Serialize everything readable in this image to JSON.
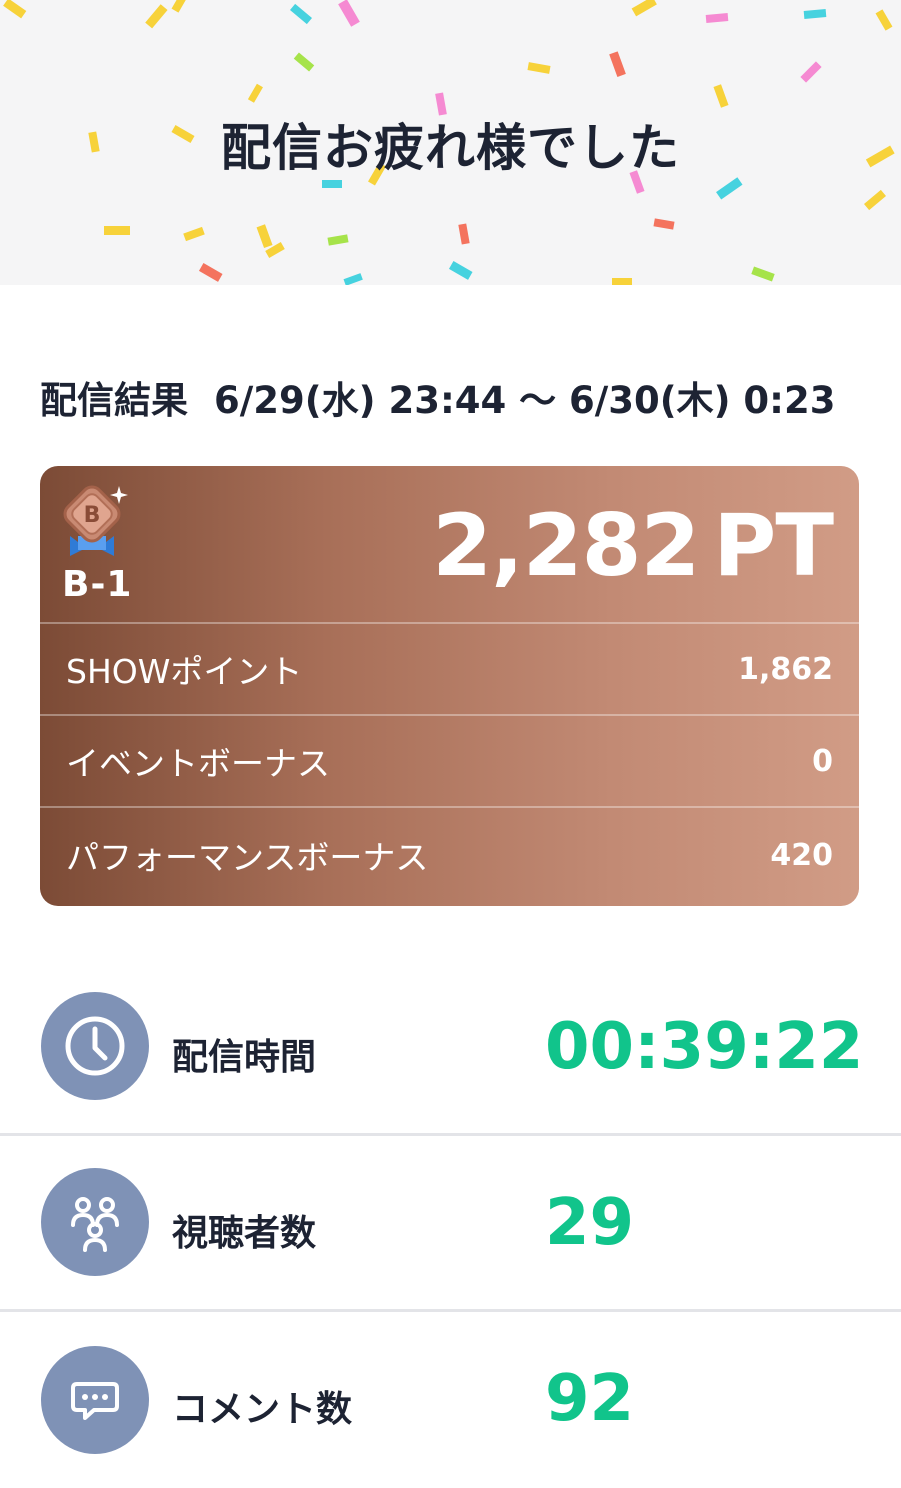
{
  "header": {
    "title": "配信お疲れ様でした"
  },
  "result": {
    "label": "配信結果",
    "period": "6/29(水) 23:44 〜 6/30(木) 0:23"
  },
  "points_card": {
    "rank_letter": "B",
    "rank": "B-1",
    "total_value": "2,282",
    "total_unit": "PT",
    "rows": [
      {
        "label": "SHOWポイント",
        "value": "1,862"
      },
      {
        "label": "イベントボーナス",
        "value": "0"
      },
      {
        "label": "パフォーマンスボーナス",
        "value": "420"
      }
    ]
  },
  "stats": [
    {
      "icon": "clock-icon",
      "label": "配信時間",
      "value": "00:39:22"
    },
    {
      "icon": "viewers-icon",
      "label": "視聴者数",
      "value": "29"
    },
    {
      "icon": "comment-icon",
      "label": "コメント数",
      "value": "92"
    }
  ],
  "colors": {
    "accent_green": "#11c48b",
    "icon_circle": "#7f92b6",
    "card_gradient_start": "#7c4b36",
    "card_gradient_end": "#d19c86",
    "header_bg": "#f5f5f6"
  }
}
